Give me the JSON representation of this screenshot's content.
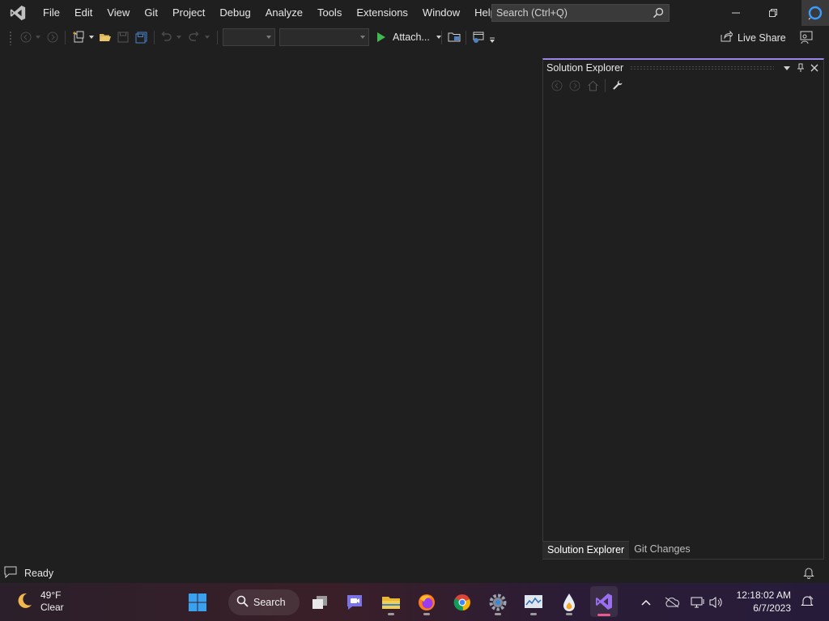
{
  "menu": {
    "items": [
      "File",
      "Edit",
      "View",
      "Git",
      "Project",
      "Debug",
      "Analyze",
      "Tools",
      "Extensions",
      "Window",
      "Help"
    ],
    "search_placeholder": "Search (Ctrl+Q)"
  },
  "toolbar": {
    "attach_label": "Attach...",
    "live_share_label": "Live Share"
  },
  "solution_explorer": {
    "title": "Solution Explorer",
    "tabs": [
      "Solution Explorer",
      "Git Changes"
    ],
    "active_tab": "Solution Explorer"
  },
  "status": {
    "text": "Ready"
  },
  "taskbar": {
    "weather_temp": "49°F",
    "weather_desc": "Clear",
    "search_label": "Search",
    "time": "12:18:02 AM",
    "date": "6/7/2023"
  },
  "colors": {
    "background": "#1f1f1f",
    "accent": "#9a86e8",
    "run_green": "#3fb950"
  }
}
